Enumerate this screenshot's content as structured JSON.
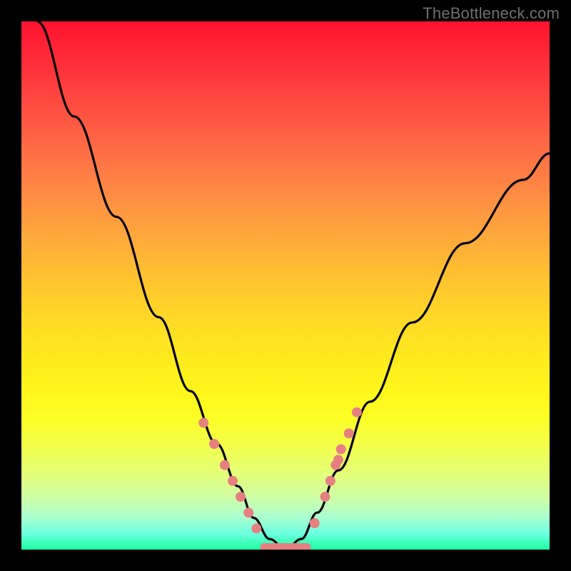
{
  "watermark": "TheBottleneck.com",
  "colors": {
    "dot": "#e68080",
    "curve": "#000000",
    "frame": "#000000"
  },
  "chart_data": {
    "type": "line",
    "title": "",
    "xlabel": "",
    "ylabel": "",
    "xlim": [
      0,
      100
    ],
    "ylim": [
      0,
      100
    ],
    "grid": false,
    "legend": false,
    "series": [
      {
        "name": "bottleneck-curve",
        "x": [
          3,
          10,
          18,
          26,
          32,
          37,
          41,
          44,
          47,
          50,
          53,
          56,
          60,
          66,
          74,
          84,
          95,
          100
        ],
        "y": [
          100,
          82,
          63,
          44,
          30,
          20,
          12,
          6,
          2,
          0,
          2,
          7,
          15,
          28,
          43,
          58,
          70,
          75
        ]
      }
    ],
    "annotations": {
      "flat_segment": {
        "x_start": 46,
        "x_end": 54,
        "y": 0
      },
      "dots_left": [
        {
          "x": 34.5,
          "y": 24
        },
        {
          "x": 36.5,
          "y": 20
        },
        {
          "x": 38.5,
          "y": 16
        },
        {
          "x": 40.0,
          "y": 13
        },
        {
          "x": 41.5,
          "y": 10
        },
        {
          "x": 43.0,
          "y": 7
        },
        {
          "x": 44.5,
          "y": 4
        }
      ],
      "dots_right": [
        {
          "x": 55.5,
          "y": 5
        },
        {
          "x": 57.5,
          "y": 10
        },
        {
          "x": 58.5,
          "y": 13
        },
        {
          "x": 59.5,
          "y": 16
        },
        {
          "x": 60.0,
          "y": 17
        },
        {
          "x": 60.5,
          "y": 19
        },
        {
          "x": 62.0,
          "y": 22
        },
        {
          "x": 63.5,
          "y": 26
        }
      ]
    }
  }
}
